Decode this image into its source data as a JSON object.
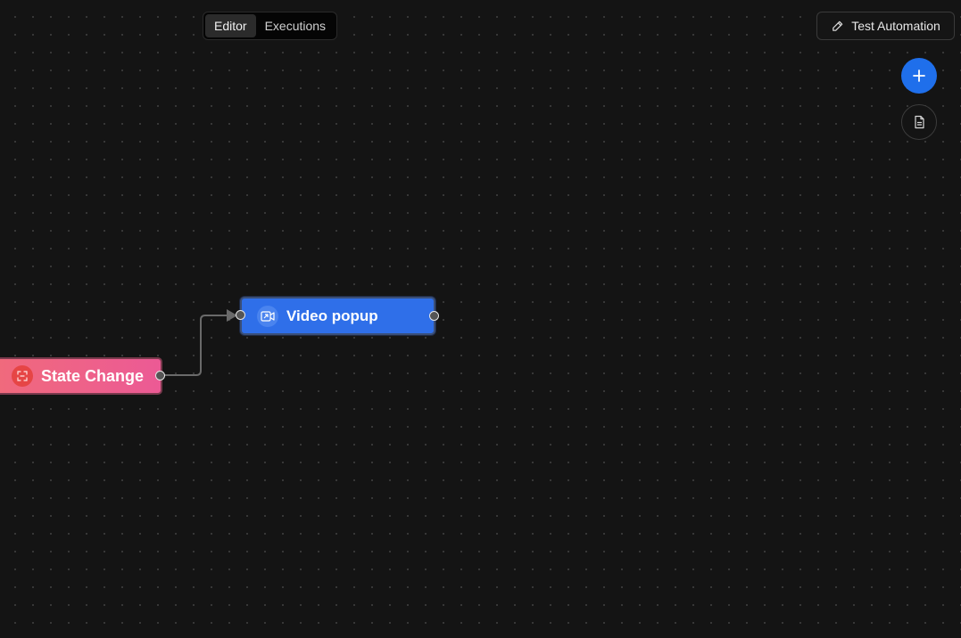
{
  "tabs": [
    {
      "label": "Editor",
      "active": true
    },
    {
      "label": "Executions",
      "active": false
    }
  ],
  "toolbar": {
    "test_label": "Test Automation"
  },
  "nodes": {
    "video": {
      "label": "Video popup",
      "icon": "video-icon",
      "color": "#2f6fe9"
    },
    "state": {
      "label": "State Change",
      "icon": "state-change-icon",
      "color": "#ec5a95"
    }
  },
  "icons": {
    "add": "plus-icon",
    "doc": "document-icon",
    "test": "pencil-icon"
  },
  "colors": {
    "canvas": "#141414",
    "accent": "#1f6feb",
    "edge": "#6a6a6a"
  }
}
